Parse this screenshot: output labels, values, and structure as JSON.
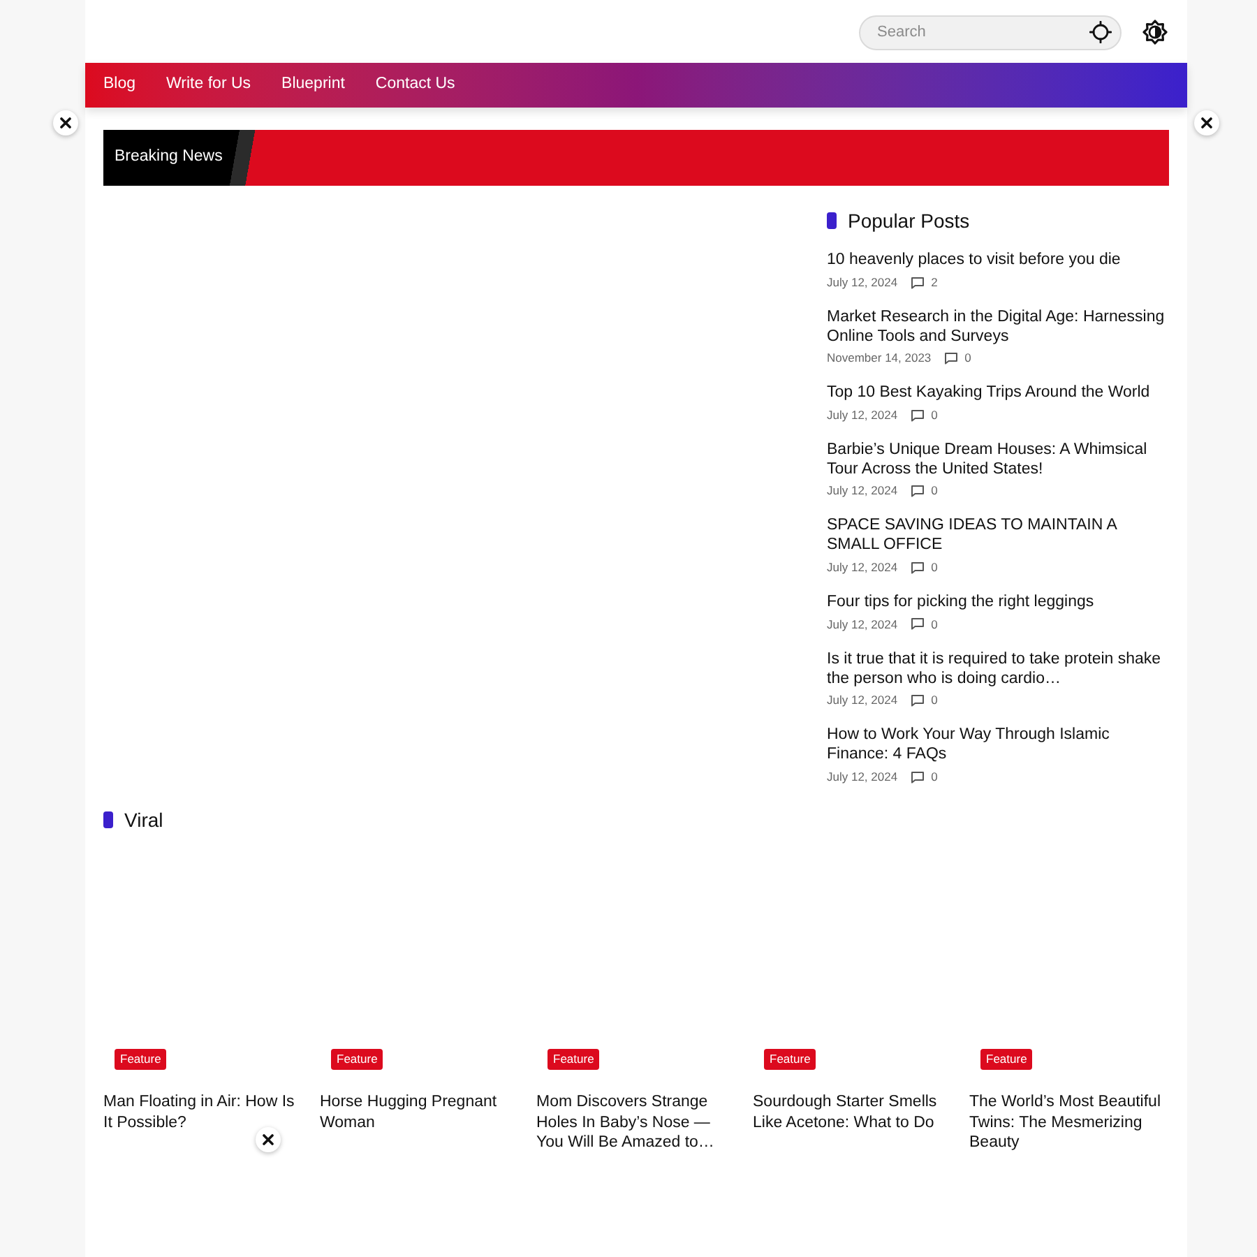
{
  "header": {
    "search": {
      "placeholder": "Search"
    }
  },
  "nav": {
    "items": [
      {
        "label": "Blog"
      },
      {
        "label": "Write for Us"
      },
      {
        "label": "Blueprint"
      },
      {
        "label": "Contact Us"
      }
    ]
  },
  "breaking_news": {
    "label": "Breaking News"
  },
  "popular_posts": {
    "title": "Popular Posts",
    "posts": [
      {
        "title": "10 heavenly places to visit before you die",
        "date": "July 12, 2024",
        "comments": "2"
      },
      {
        "title": "Market Research in the Digital Age: Harnessing Online Tools and Surveys",
        "date": "November 14, 2023",
        "comments": "0"
      },
      {
        "title": "Top 10 Best Kayaking Trips Around the World",
        "date": "July 12, 2024",
        "comments": "0"
      },
      {
        "title": "Barbie’s Unique Dream Houses: A Whimsical Tour Across the United States!",
        "date": "July 12, 2024",
        "comments": "0"
      },
      {
        "title": "SPACE SAVING IDEAS TO MAINTAIN A SMALL OFFICE",
        "date": "July 12, 2024",
        "comments": "0"
      },
      {
        "title": "Four tips for picking the right leggings",
        "date": "July 12, 2024",
        "comments": "0"
      },
      {
        "title": "Is it true that it is required to take protein shake the person who is doing cardio…",
        "date": "July 12, 2024",
        "comments": "0"
      },
      {
        "title": "How to Work Your Way Through Islamic Finance: 4 FAQs",
        "date": "July 12, 2024",
        "comments": "0"
      }
    ]
  },
  "viral": {
    "title": "Viral",
    "cards": [
      {
        "tag": "Feature",
        "title": "Man Floating in Air: How Is It Possible?"
      },
      {
        "tag": "Feature",
        "title": "Horse Hugging Pregnant Woman"
      },
      {
        "tag": "Feature",
        "title": "Mom Discovers Strange Holes In Baby’s Nose — You Will Be Amazed to…"
      },
      {
        "tag": "Feature",
        "title": "Sourdough Starter Smells Like Acetone: What to Do"
      },
      {
        "tag": "Feature",
        "title": "The World’s Most Beautiful Twins: The Mesmerizing Beauty"
      }
    ]
  }
}
